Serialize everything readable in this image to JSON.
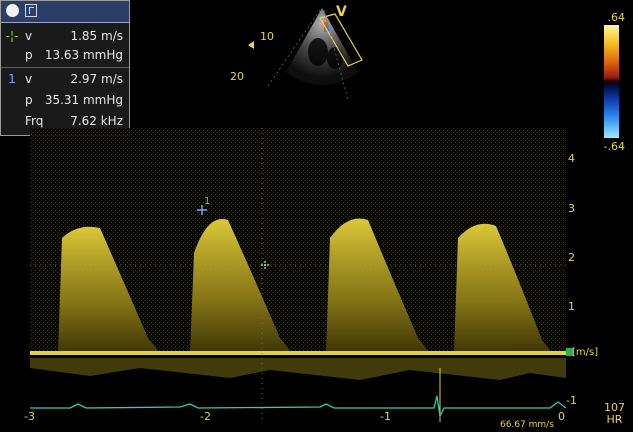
{
  "measurements": [
    {
      "marker": "-¦-",
      "label": "v",
      "value": "1.85 m/s",
      "color": "#9adb54"
    },
    {
      "marker": "",
      "label": "p",
      "value": "13.63 mmHg",
      "color": "#e8e8e8"
    },
    {
      "marker": "1",
      "label": "v",
      "value": "2.97 m/s",
      "color": "#6fa4ff"
    },
    {
      "marker": "",
      "label": "p",
      "value": "35.31 mmHg",
      "color": "#e8e8e8"
    },
    {
      "marker": "",
      "label": "Frq",
      "value": "7.62 kHz",
      "color": "#e8e8e8"
    }
  ],
  "sector": {
    "label": "V",
    "depth_marks": [
      "10",
      "20"
    ]
  },
  "color_bar": {
    "top": ".64",
    "bottom": "-.64"
  },
  "velocity_axis": {
    "ticks": [
      "4",
      "3",
      "2",
      "1",
      "-1"
    ],
    "unit": "[m/s]"
  },
  "time_axis": {
    "ticks": [
      "-3",
      "-2",
      "-1",
      "0"
    ]
  },
  "hr": {
    "value": "107",
    "label": "HR"
  },
  "sweep": "66.67 mm/s",
  "cursor_markers": [
    {
      "label": "+1",
      "velocity": 2.97
    },
    {
      "label": "+",
      "velocity": 1.85
    }
  ],
  "colors": {
    "spectrum": "#d8c21f",
    "baseline": "#e0d24a",
    "ecg": "#2bd0b0"
  }
}
